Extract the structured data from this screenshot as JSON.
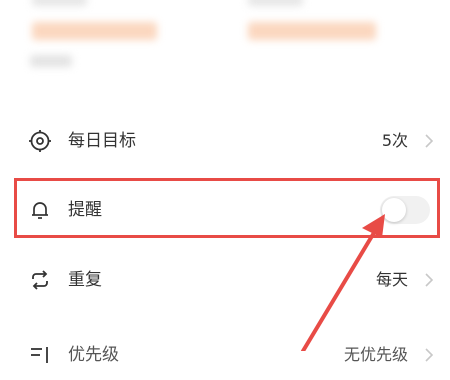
{
  "settings": {
    "daily_goal": {
      "label": "每日目标",
      "value": "5次"
    },
    "reminder": {
      "label": "提醒",
      "enabled": false
    },
    "repeat": {
      "label": "重复",
      "value": "每天"
    },
    "priority": {
      "label": "优先级",
      "value": "无优先级"
    }
  },
  "annotation": {
    "color": "#e84b46"
  }
}
